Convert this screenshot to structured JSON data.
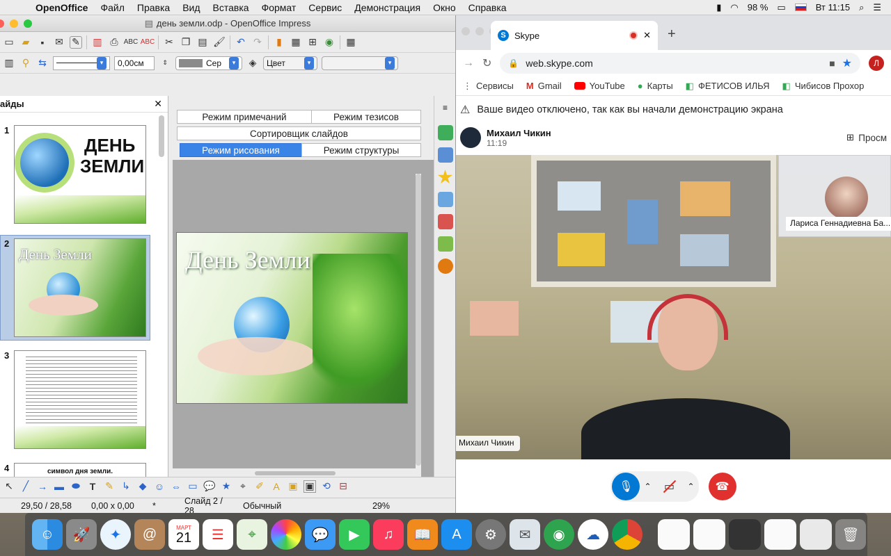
{
  "menubar": {
    "app": "OpenOffice",
    "items": [
      "Файл",
      "Правка",
      "Вид",
      "Вставка",
      "Формат",
      "Сервис",
      "Демонстрация",
      "Окно",
      "Справка"
    ],
    "battery": "98 %",
    "clock": "Вт 11:15"
  },
  "oo": {
    "title": "день земли.odp - OpenOffice Impress",
    "line_width": "0,00см",
    "fill_color": "Сер",
    "area_style": "Цвет",
    "slides_header": "айды",
    "view_tabs": {
      "notes": "Режим примечаний",
      "handout": "Режим тезисов",
      "sorter": "Сортировщик слайдов",
      "drawing": "Режим рисования",
      "outline": "Режим структуры"
    },
    "thumbs": {
      "n1": "1",
      "t1a": "ДЕНЬ",
      "t1b": "ЗЕМЛИ",
      "n2": "2",
      "t2": "День Земли",
      "n3": "3",
      "n4": "4",
      "t4": "символ дня земли."
    },
    "slide_title": "День Земли",
    "status": {
      "position": "29,50 / 28,58",
      "size": "0,00 x 0,00",
      "modified": "*",
      "slide": "Слайд 2 / 28",
      "layout": "Обычный",
      "zoom": "29%"
    }
  },
  "chrome": {
    "tab_title": "Skype",
    "url": "web.skype.com",
    "bookmarks": [
      "Сервисы",
      "Gmail",
      "YouTube",
      "Карты",
      "ФЕТИСОВ ИЛЬЯ",
      "Чибисов Прохор"
    ],
    "profile_letter": "Л"
  },
  "skype": {
    "notice": "Ваше видео отключено, так как вы начали демонстрацию экрана",
    "caller": "Михаил Чикин",
    "time": "11:19",
    "view_button": "Просм",
    "remote_name": "Лариса Геннадиевна Ба...",
    "local_label": "Михаил Чикин"
  },
  "dock": {
    "calendar_month": "МАРТ",
    "calendar_day": "21"
  },
  "colors": {
    "accent_blue": "#3a84e8",
    "skype_blue": "#0078d4",
    "end_call_red": "#e0312f"
  }
}
